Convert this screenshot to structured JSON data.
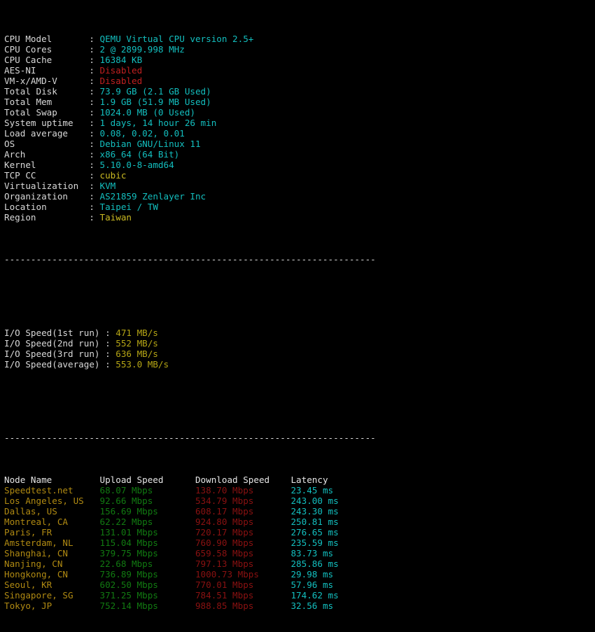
{
  "colors": {
    "background": "#000000",
    "label": "#d9d9d9",
    "value_cyan": "#13bfbf",
    "value_yellow": "#b5a515",
    "value_red": "#c02020",
    "upload_green": "#117a11",
    "download_red": "#8a1111",
    "node_orange": "#b08a12",
    "latency_cyan": "#13bfbf",
    "header_white": "#e6e6e6"
  },
  "sysinfo": {
    "rows": [
      {
        "label": "CPU Model",
        "value": "QEMU Virtual CPU version 2.5+",
        "style": "cyan"
      },
      {
        "label": "CPU Cores",
        "value": "2 @ 2899.998 MHz",
        "style": "cyan"
      },
      {
        "label": "CPU Cache",
        "value": "16384 KB",
        "style": "cyan"
      },
      {
        "label": "AES-NI",
        "value": "Disabled",
        "style": "red"
      },
      {
        "label": "VM-x/AMD-V",
        "value": "Disabled",
        "style": "red"
      },
      {
        "label": "Total Disk",
        "value": "73.9 GB (2.1 GB Used)",
        "style": "cyan"
      },
      {
        "label": "Total Mem",
        "value": "1.9 GB (51.9 MB Used)",
        "style": "cyan"
      },
      {
        "label": "Total Swap",
        "value": "1024.0 MB (0 Used)",
        "style": "cyan"
      },
      {
        "label": "System uptime",
        "value": "1 days, 14 hour 26 min",
        "style": "cyan"
      },
      {
        "label": "Load average",
        "value": "0.08, 0.02, 0.01",
        "style": "cyan"
      },
      {
        "label": "OS",
        "value": "Debian GNU/Linux 11",
        "style": "cyan"
      },
      {
        "label": "Arch",
        "value": "x86_64 (64 Bit)",
        "style": "cyan"
      },
      {
        "label": "Kernel",
        "value": "5.10.0-8-amd64",
        "style": "cyan"
      },
      {
        "label": "TCP CC",
        "value": "cubic",
        "style": "yellow"
      },
      {
        "label": "Virtualization",
        "value": "KVM",
        "style": "cyan"
      },
      {
        "label": "Organization",
        "value": "AS21859 Zenlayer Inc",
        "style": "cyan"
      },
      {
        "label": "Location",
        "value": "Taipei / TW",
        "style": "cyan"
      },
      {
        "label": "Region",
        "value": "Taiwan",
        "style": "yellow"
      }
    ]
  },
  "separator": "----------------------------------------------------------------------",
  "iospeed": {
    "rows": [
      {
        "label": "I/O Speed(1st run)",
        "value": "471 MB/s"
      },
      {
        "label": "I/O Speed(2nd run)",
        "value": "552 MB/s"
      },
      {
        "label": "I/O Speed(3rd run)",
        "value": "636 MB/s"
      },
      {
        "label": "I/O Speed(average)",
        "value": "553.0 MB/s"
      }
    ]
  },
  "speedtest": {
    "headers": {
      "node": "Node Name",
      "upload": "Upload Speed",
      "download": "Download Speed",
      "latency": "Latency"
    },
    "rows": [
      {
        "node": "Speedtest.net",
        "upload": "68.07 Mbps",
        "download": "138.70 Mbps",
        "latency": "23.45 ms"
      },
      {
        "node": "Los Angeles, US",
        "upload": "92.66 Mbps",
        "download": "534.79 Mbps",
        "latency": "243.00 ms"
      },
      {
        "node": "Dallas, US",
        "upload": "156.69 Mbps",
        "download": "608.17 Mbps",
        "latency": "243.30 ms"
      },
      {
        "node": "Montreal, CA",
        "upload": "62.22 Mbps",
        "download": "924.80 Mbps",
        "latency": "250.81 ms"
      },
      {
        "node": "Paris, FR",
        "upload": "131.01 Mbps",
        "download": "720.17 Mbps",
        "latency": "276.65 ms"
      },
      {
        "node": "Amsterdam, NL",
        "upload": "115.04 Mbps",
        "download": "760.90 Mbps",
        "latency": "235.59 ms"
      },
      {
        "node": "Shanghai, CN",
        "upload": "379.75 Mbps",
        "download": "659.58 Mbps",
        "latency": "83.73 ms"
      },
      {
        "node": "Nanjing, CN",
        "upload": "22.68 Mbps",
        "download": "797.13 Mbps",
        "latency": "285.86 ms"
      },
      {
        "node": "Hongkong, CN",
        "upload": "736.89 Mbps",
        "download": "1000.73 Mbps",
        "latency": "29.98 ms"
      },
      {
        "node": "Seoul, KR",
        "upload": "602.50 Mbps",
        "download": "770.01 Mbps",
        "latency": "57.96 ms"
      },
      {
        "node": "Singapore, SG",
        "upload": "371.25 Mbps",
        "download": "784.51 Mbps",
        "latency": "174.62 ms"
      },
      {
        "node": "Tokyo, JP",
        "upload": "752.14 Mbps",
        "download": "988.85 Mbps",
        "latency": "32.56 ms"
      }
    ]
  }
}
